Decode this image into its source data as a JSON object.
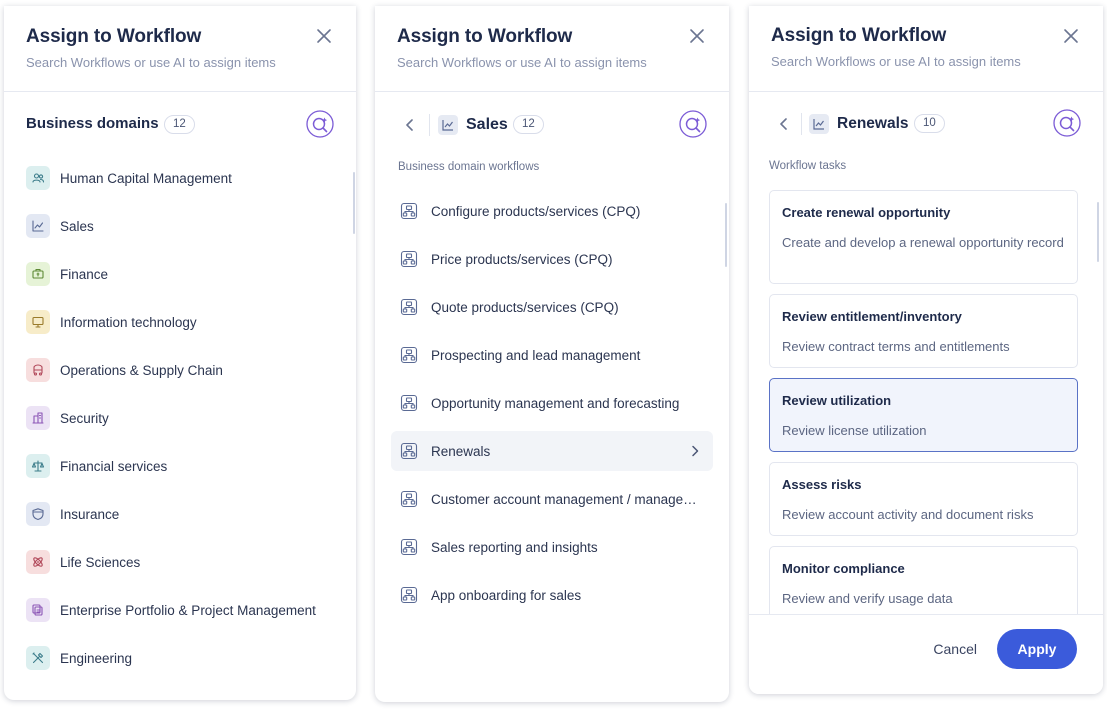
{
  "colors": {
    "accent": "#3b5bdb",
    "ai_icon": "#7c5cd6",
    "selected_border": "#5a72c6",
    "selected_bg": "#f1f4fc"
  },
  "panel1": {
    "title": "Assign to Workflow",
    "subtitle": "Search Workflows or use AI to assign items",
    "section_title": "Business domains",
    "count": "12",
    "domains": [
      {
        "label": "Human Capital Management",
        "icon": "people-icon",
        "bg": "#dcefef",
        "fg": "#3b7c8a"
      },
      {
        "label": "Sales",
        "icon": "line-chart-icon",
        "bg": "#e3e8f3",
        "fg": "#5a6a94"
      },
      {
        "label": "Finance",
        "icon": "money-icon",
        "bg": "#e6f3d7",
        "fg": "#5e8a36"
      },
      {
        "label": "Information technology",
        "icon": "monitor-icon",
        "bg": "#f7ecc9",
        "fg": "#9a7a2a"
      },
      {
        "label": "Operations & Supply Chain",
        "icon": "truck-icon",
        "bg": "#f7dede",
        "fg": "#b1485a"
      },
      {
        "label": "Security",
        "icon": "shield-building-icon",
        "bg": "#ece3f5",
        "fg": "#8b55b5"
      },
      {
        "label": "Financial services",
        "icon": "scales-icon",
        "bg": "#dcefef",
        "fg": "#3b7c8a"
      },
      {
        "label": "Insurance",
        "icon": "insurance-shield-icon",
        "bg": "#e3e8f3",
        "fg": "#5a6a94"
      },
      {
        "label": "Life Sciences",
        "icon": "atom-icon",
        "bg": "#f7dede",
        "fg": "#b1485a"
      },
      {
        "label": "Enterprise Portfolio & Project Management",
        "icon": "portfolio-icon",
        "bg": "#ece3f5",
        "fg": "#8b55b5"
      },
      {
        "label": "Engineering",
        "icon": "tools-icon",
        "bg": "#dcefef",
        "fg": "#3b7c8a"
      }
    ]
  },
  "panel2": {
    "title": "Assign to Workflow",
    "subtitle": "Search Workflows or use AI to assign items",
    "crumb_title": "Sales",
    "count": "12",
    "list_heading": "Business domain workflows",
    "workflows": [
      "Configure products/services (CPQ)",
      "Price products/services (CPQ)",
      "Quote products/services (CPQ)",
      "Prospecting and lead management",
      "Opportunity management and forecasting",
      "Renewals",
      "Customer account management / management",
      "Sales reporting and insights",
      "App onboarding for sales"
    ]
  },
  "panel3": {
    "title": "Assign to Workflow",
    "subtitle": "Search Workflows or use AI to assign items",
    "crumb_title": "Renewals",
    "count": "10",
    "list_heading": "Workflow tasks",
    "tasks": [
      {
        "title": "Create renewal opportunity",
        "desc": "Create and develop a renewal opportunity record"
      },
      {
        "title": "Review entitlement/inventory",
        "desc": "Review contract terms and entitlements"
      },
      {
        "title": "Review utilization",
        "desc": "Review license utilization"
      },
      {
        "title": "Assess risks",
        "desc": "Review account activity and document risks"
      },
      {
        "title": "Monitor compliance",
        "desc": "Review and verify usage data"
      }
    ],
    "cancel_label": "Cancel",
    "apply_label": "Apply"
  }
}
